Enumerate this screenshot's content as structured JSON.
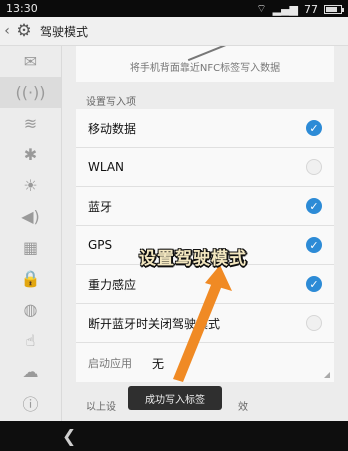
{
  "status_bar": {
    "time": "13:30",
    "battery_text": "77",
    "battery_level": 0.77
  },
  "app_bar": {
    "title": "驾驶模式"
  },
  "sidebar": {
    "items": [
      {
        "icon": "email-icon"
      },
      {
        "icon": "nfc-icon",
        "active": true
      },
      {
        "icon": "wifi-icon"
      },
      {
        "icon": "bluetooth-icon"
      },
      {
        "icon": "brightness-icon"
      },
      {
        "icon": "volume-icon"
      },
      {
        "icon": "apps-icon"
      },
      {
        "icon": "lock-location-icon"
      },
      {
        "icon": "globe-icon"
      },
      {
        "icon": "touch-icon"
      },
      {
        "icon": "cloud-icon"
      },
      {
        "icon": "info-icon"
      }
    ]
  },
  "content": {
    "nfc_hint": "将手机背面靠近NFC标签写入数据",
    "section_label": "设置写入项",
    "items": [
      {
        "label": "移动数据",
        "checked": true
      },
      {
        "label": "WLAN",
        "checked": false
      },
      {
        "label": "蓝牙",
        "checked": true
      },
      {
        "label": "GPS",
        "checked": true
      },
      {
        "label": "重力感应",
        "checked": true
      },
      {
        "label": "断开蓝牙时关闭驾驶模式",
        "checked": false
      }
    ],
    "launch_app": {
      "label": "启动应用",
      "value": "无"
    },
    "footer_left": "以上设",
    "footer_right": "效"
  },
  "toast": {
    "text": "成功写入标签"
  },
  "annotation": {
    "text": "设置驾驶模式",
    "color": "#f08a24"
  }
}
